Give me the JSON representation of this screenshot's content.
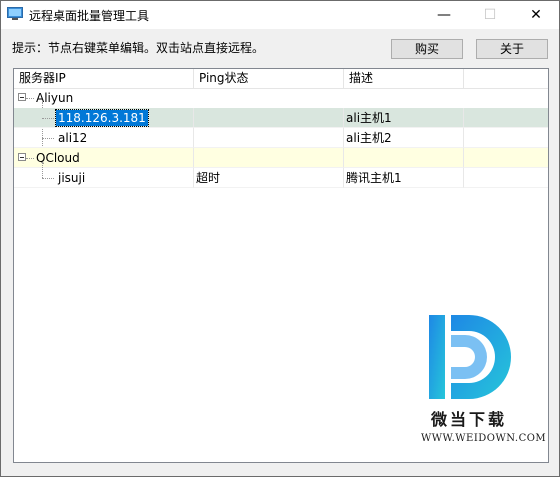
{
  "window": {
    "title": "远程桌面批量管理工具",
    "controls": {
      "minimize": "—",
      "maximize": "☐",
      "close": "✕"
    }
  },
  "toolbar": {
    "hint": "提示：节点右键菜单编辑。双击站点直接远程。",
    "buy_label": "购买",
    "about_label": "关于"
  },
  "tree": {
    "headers": [
      "服务器IP",
      "Ping状态",
      "描述",
      ""
    ],
    "rows": [
      {
        "name": "Aliyun",
        "ping": "",
        "desc": ""
      },
      {
        "name": "118.126.3.181",
        "ping": "",
        "desc": "ali主机1"
      },
      {
        "name": "ali12",
        "ping": "",
        "desc": "ali主机2"
      },
      {
        "name": "QCloud",
        "ping": "",
        "desc": ""
      },
      {
        "name": "jisuji",
        "ping": "超时",
        "desc": "腾讯主机1"
      }
    ]
  },
  "watermark": {
    "text": "微当下载",
    "url": "WWW.WEIDOWN.COM"
  },
  "colors": {
    "selection": "#0078d7",
    "selected_row": "#d9e6de",
    "hover_row": "#ffffe1",
    "logo_blue": "#1e88e5"
  }
}
